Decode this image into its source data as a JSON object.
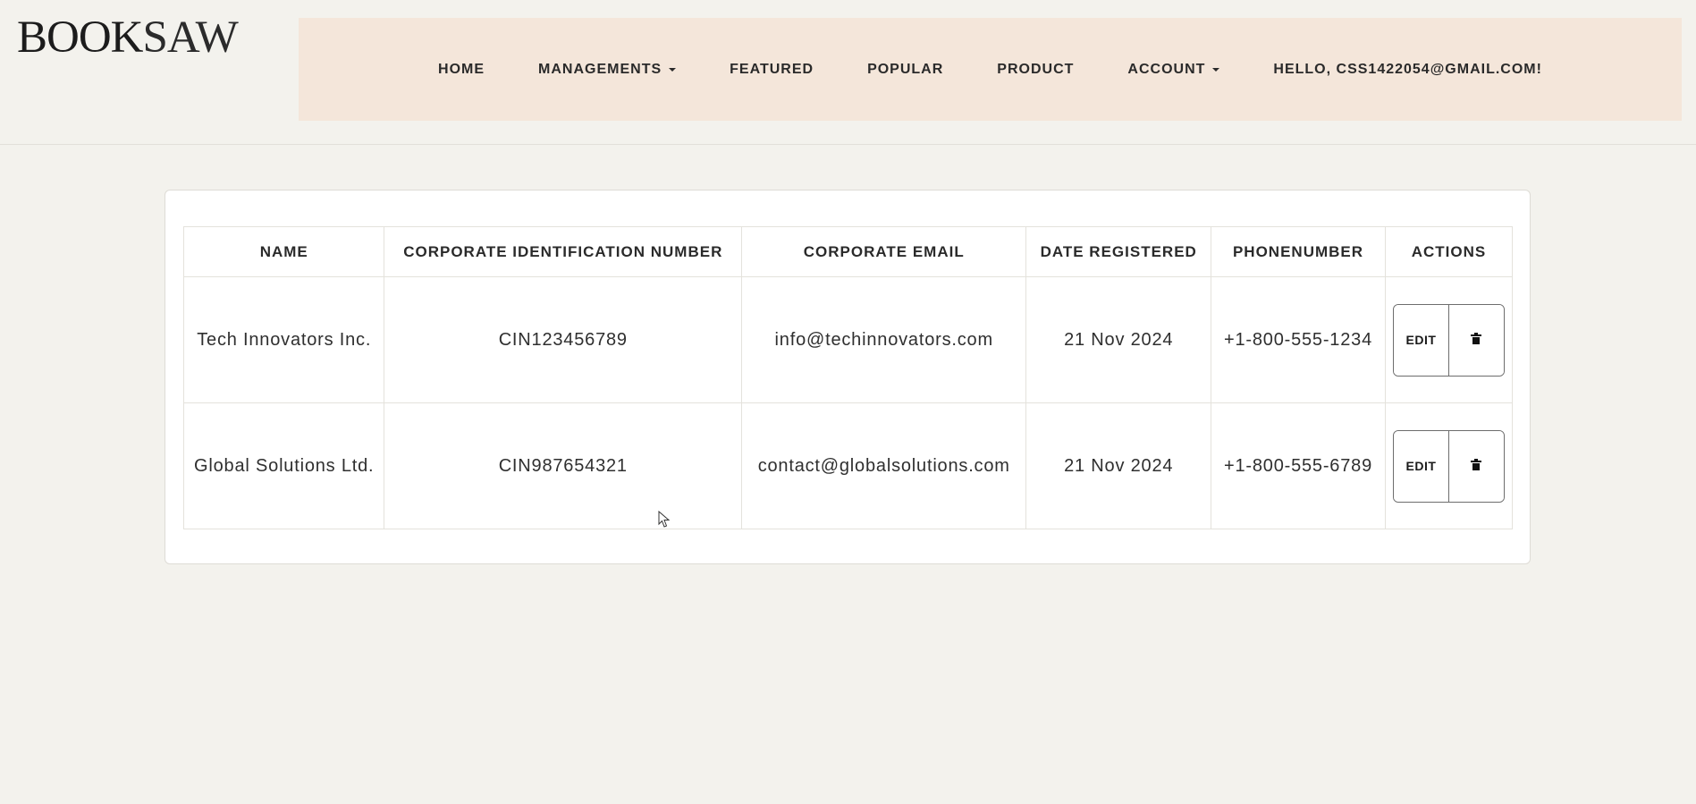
{
  "brand": {
    "logo_bold": "BOOK",
    "logo_light": "SAW"
  },
  "nav": {
    "items": [
      {
        "label": "HOME",
        "dropdown": false
      },
      {
        "label": "MANAGEMENTS",
        "dropdown": true
      },
      {
        "label": "FEATURED",
        "dropdown": false
      },
      {
        "label": "POPULAR",
        "dropdown": false
      },
      {
        "label": "PRODUCT",
        "dropdown": false
      },
      {
        "label": "ACCOUNT",
        "dropdown": true
      },
      {
        "label": "HELLO, CSS1422054@GMAIL.COM!",
        "dropdown": false
      }
    ]
  },
  "table": {
    "headers": {
      "name": "NAME",
      "cin": "CORPORATE IDENTIFICATION NUMBER",
      "email": "CORPORATE EMAIL",
      "date": "DATE REGISTERED",
      "phone": "PHONENUMBER",
      "actions": "ACTIONS"
    },
    "rows": [
      {
        "name": "Tech Innovators Inc.",
        "cin": "CIN123456789",
        "email": "info@techinnovators.com",
        "date": "21 Nov 2024",
        "phone": "+1-800-555-1234",
        "edit_label": "EDIT"
      },
      {
        "name": "Global Solutions Ltd.",
        "cin": "CIN987654321",
        "email": "contact@globalsolutions.com",
        "date": "21 Nov 2024",
        "phone": "+1-800-555-6789",
        "edit_label": "EDIT"
      }
    ]
  },
  "icons": {
    "delete": "trash-icon",
    "dropdown": "caret-down-icon",
    "pointer": "mouse-pointer-icon"
  },
  "colors": {
    "background": "#f3f2ed",
    "navbar": "#f4e6da",
    "card": "#ffffff",
    "text": "#2a2a2a"
  }
}
